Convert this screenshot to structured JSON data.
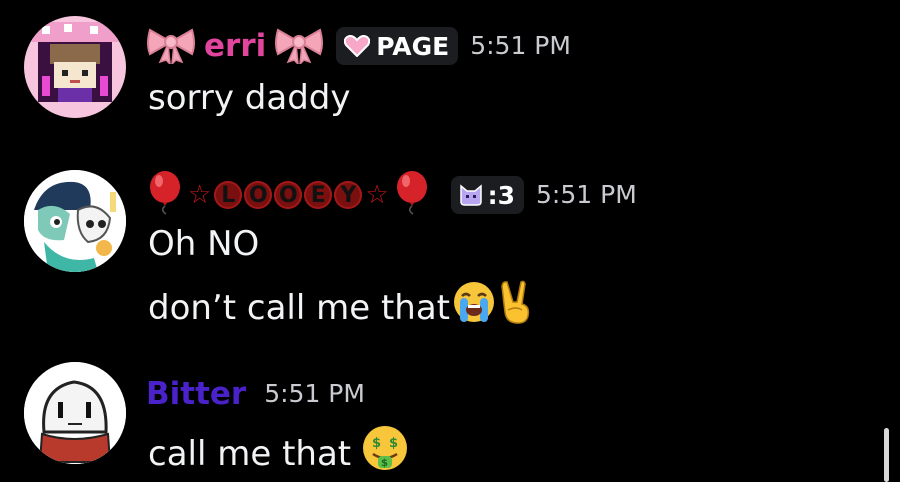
{
  "messages": [
    {
      "username": "erri",
      "name_color": "#e1459e",
      "tag": {
        "icon": "heart-icon",
        "label": "PAGE"
      },
      "time": "5:51 PM",
      "lines": [
        "sorry daddy"
      ]
    },
    {
      "username": "LOOEY",
      "name_letters": [
        "L",
        "O",
        "O",
        "E",
        "Y"
      ],
      "name_color": "#c2171a",
      "tag": {
        "icon": "cat-icon",
        "label": ":3"
      },
      "time": "5:51 PM",
      "lines": [
        "Oh NO",
        "don’t call me that"
      ]
    },
    {
      "username": "Bitter",
      "name_color": "#4a22c9",
      "time": "5:51 PM",
      "lines": [
        "call me that"
      ]
    }
  ],
  "colors": {
    "background": "#000000",
    "text": "#f2f3f5",
    "timestamp": "#c9cbd0",
    "tag_background": "#1c1d21"
  }
}
